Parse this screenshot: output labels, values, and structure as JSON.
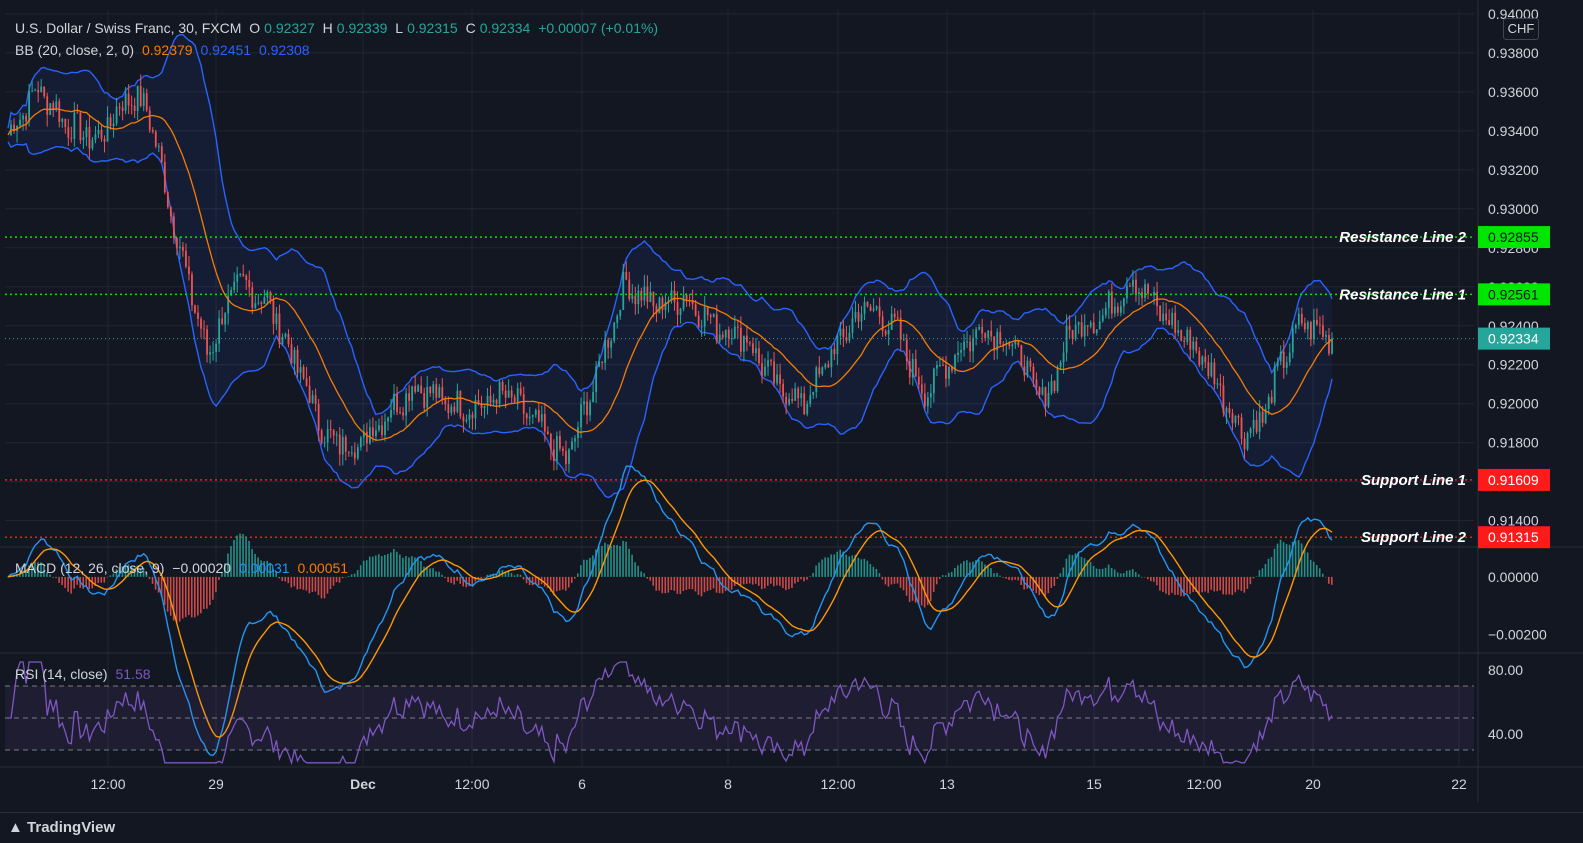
{
  "legend": {
    "symbol": "U.S. Dollar / Swiss Franc, 30, FXCM",
    "o_label": "O",
    "o": "0.92327",
    "h_label": "H",
    "h": "0.92339",
    "l_label": "L",
    "l": "0.92315",
    "c_label": "C",
    "c": "0.92334",
    "change": "+0.00007 (+0.01%)"
  },
  "bb_legend": {
    "label": "BB (20, close, 2, 0)",
    "basis": "0.92379",
    "upper": "0.92451",
    "lower": "0.92308"
  },
  "macd_legend": {
    "label": "MACD (12, 26, close, 9)",
    "hist": "−0.00020",
    "macd": "0.00031",
    "signal": "0.00051"
  },
  "rsi_legend": {
    "label": "RSI (14, close)",
    "value": "51.58"
  },
  "currency": "CHF",
  "branding": "TradingView",
  "colors": {
    "background": "#131722",
    "grid": "#232632",
    "up": "#26a69a",
    "down": "#ef5350",
    "bb_band": "#2962ff",
    "bb_basis": "#f57c00",
    "macd": "#2196f3",
    "signal": "#ff9800",
    "rsi": "#7e57c2",
    "resistance": "#00e600",
    "support": "#ff1a1a",
    "last_price": "#26a69a"
  },
  "chart_data": [
    {
      "type": "candlestick",
      "title": "U.S. Dollar / Swiss Franc, 30, FXCM",
      "ylim": [
        0.9127,
        0.9402
      ],
      "y_ticks": [
        "0.94000",
        "0.93800",
        "0.93600",
        "0.93400",
        "0.93200",
        "0.93000",
        "0.92800",
        "0.92600",
        "0.92400",
        "0.92200",
        "0.92000",
        "0.91800",
        "0.91400"
      ],
      "x_ticks": [
        "12:00",
        "29",
        "Dec",
        "12:00",
        "6",
        "8",
        "12:00",
        "13",
        "15",
        "12:00",
        "20",
        "22"
      ],
      "price_path": [
        [
          0,
          0.9338
        ],
        [
          3,
          0.9362
        ],
        [
          6,
          0.9343
        ],
        [
          9,
          0.9335
        ],
        [
          12,
          0.9358
        ],
        [
          14,
          0.9352
        ],
        [
          17,
          0.9285
        ],
        [
          20,
          0.9225
        ],
        [
          23,
          0.9262
        ],
        [
          26,
          0.9253
        ],
        [
          29,
          0.922
        ],
        [
          32,
          0.9182
        ],
        [
          35,
          0.9178
        ],
        [
          38,
          0.9195
        ],
        [
          41,
          0.921
        ],
        [
          44,
          0.92
        ],
        [
          47,
          0.9198
        ],
        [
          50,
          0.9205
        ],
        [
          53,
          0.919
        ],
        [
          56,
          0.917
        ],
        [
          59,
          0.9212
        ],
        [
          62,
          0.9262
        ],
        [
          65,
          0.925
        ],
        [
          68,
          0.9255
        ],
        [
          71,
          0.924
        ],
        [
          74,
          0.9235
        ],
        [
          77,
          0.921
        ],
        [
          80,
          0.92
        ],
        [
          83,
          0.9228
        ],
        [
          86,
          0.925
        ],
        [
          89,
          0.924
        ],
        [
          92,
          0.9205
        ],
        [
          95,
          0.9225
        ],
        [
          98,
          0.924
        ],
        [
          101,
          0.923
        ],
        [
          104,
          0.92
        ],
        [
          107,
          0.924
        ],
        [
          110,
          0.9245
        ],
        [
          113,
          0.9265
        ],
        [
          116,
          0.9245
        ],
        [
          119,
          0.923
        ],
        [
          121,
          0.9215
        ],
        [
          124,
          0.9185
        ],
        [
          126,
          0.9192
        ],
        [
          128,
          0.9222
        ],
        [
          130,
          0.9242
        ],
        [
          133,
          0.9233
        ]
      ],
      "last_price": "0.92334",
      "lines": [
        {
          "name": "Resistance Line 2",
          "value": 0.92855,
          "label": "0.92855",
          "kind": "resistance"
        },
        {
          "name": "Resistance Line 1",
          "value": 0.92561,
          "label": "0.92561",
          "kind": "resistance"
        },
        {
          "name": "Support Line 1",
          "value": 0.91609,
          "label": "0.91609",
          "kind": "support"
        },
        {
          "name": "Support Line 2",
          "value": 0.91315,
          "label": "0.91315",
          "kind": "support"
        }
      ],
      "indicator": {
        "name": "BB",
        "period": 20,
        "mult": 2
      }
    },
    {
      "type": "line",
      "title": "MACD (12, 26, close, 9)",
      "ylim": [
        -0.0026,
        0.001
      ],
      "y_ticks": [
        "0.00000",
        "−0.00200"
      ],
      "series": [
        {
          "name": "MACD"
        },
        {
          "name": "Signal"
        },
        {
          "name": "Histogram"
        }
      ]
    },
    {
      "type": "line",
      "title": "RSI (14, close)",
      "ylim": [
        20,
        90
      ],
      "y_ticks": [
        "80.00",
        "40.00"
      ],
      "bands": [
        70,
        50,
        30
      ],
      "last_value": 51.58
    }
  ]
}
